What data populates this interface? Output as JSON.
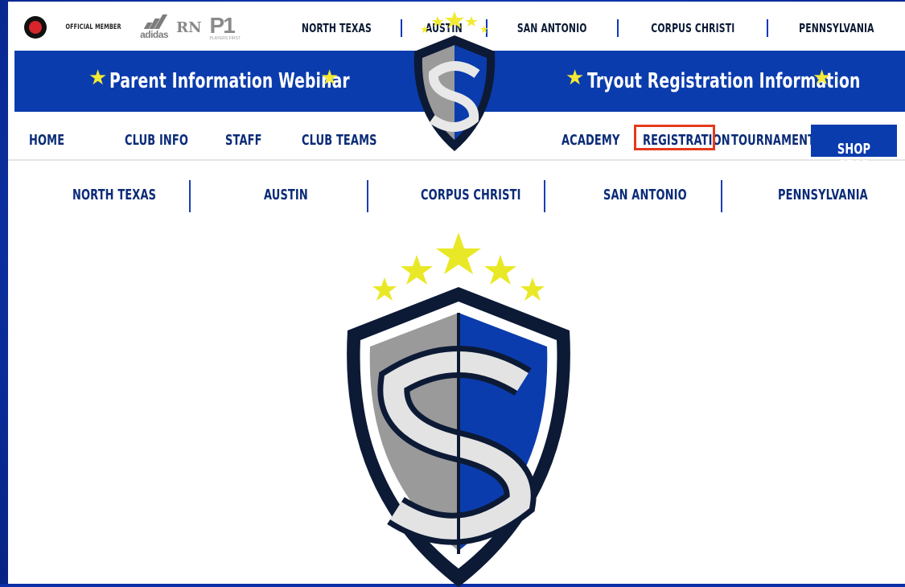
{
  "official_label": "OFFICIAL MEMBER",
  "partner_logos": {
    "adidas": "adidas",
    "rn": "RN",
    "p1": "P1",
    "p1_sub": "PLAYERS FIRST"
  },
  "regions_top": [
    "NORTH TEXAS",
    "AUSTIN",
    "SAN ANTONIO",
    "CORPUS CHRISTI",
    "PENNSYLVANIA"
  ],
  "banner": {
    "left_link": "Parent Information Webinar",
    "right_link": "Tryout Registration Information",
    "star_glyph": "★"
  },
  "mainnav": {
    "home": "HOME",
    "club_info": "CLUB INFO",
    "staff": "STAFF",
    "club_teams": "CLUB TEAMS",
    "academy": "ACADEMY",
    "registration": "REGISTRATION",
    "tournaments": "TOURNAMENTS",
    "shop_gear": "SHOP GEAR"
  },
  "subnav": [
    "NORTH TEXAS",
    "AUSTIN",
    "CORPUS CHRISTI",
    "SAN ANTONIO",
    "PENNSYLVANIA"
  ],
  "colors": {
    "brand_blue": "#0b3cad",
    "navy": "#0c1a35",
    "star_yellow": "#f2ea35",
    "highlight_red": "#e33a1c"
  },
  "icons": {
    "ball": "soccer-ball-icon",
    "shield": "club-shield-logo"
  }
}
